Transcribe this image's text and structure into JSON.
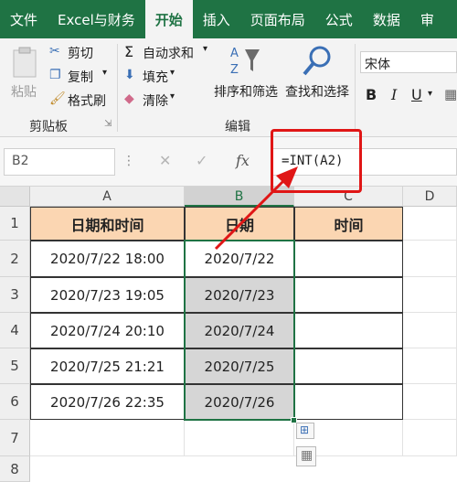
{
  "tabs": [
    "文件",
    "Excel与财务",
    "开始",
    "插入",
    "页面布局",
    "公式",
    "数据",
    "审"
  ],
  "active_tab": "开始",
  "clipboard": {
    "paste": "粘贴",
    "cut": "剪切",
    "copy": "复制",
    "format_painter": "格式刷",
    "label": "剪贴板"
  },
  "editing": {
    "autosum": "自动求和",
    "fill": "填充",
    "clear": "清除",
    "sort_filter": "排序和筛选",
    "find_select": "查找和选择",
    "label": "编辑"
  },
  "font": {
    "name": "宋体",
    "bold": "B",
    "italic": "I",
    "underline": "U"
  },
  "formula_bar": {
    "name_box": "B2",
    "fx": "fx",
    "formula": "=INT(A2)"
  },
  "columns": [
    "A",
    "B",
    "C",
    "D"
  ],
  "rows": [
    "1",
    "2",
    "3",
    "4",
    "5",
    "6",
    "7",
    "8"
  ],
  "table": {
    "headers": [
      "日期和时间",
      "日期",
      "时间"
    ],
    "datetime": [
      "2020/7/22  18:00",
      "2020/7/23  19:05",
      "2020/7/24  20:10",
      "2020/7/25  21:21",
      "2020/7/26  22:35"
    ],
    "date": [
      "2020/7/22",
      "2020/7/23",
      "2020/7/24",
      "2020/7/25",
      "2020/7/26"
    ],
    "time": [
      "",
      "",
      "",
      "",
      ""
    ]
  },
  "colors": {
    "ribbon_green": "#1f7344",
    "header_fill": "#fbd6b2",
    "highlight_red": "#e01616"
  }
}
